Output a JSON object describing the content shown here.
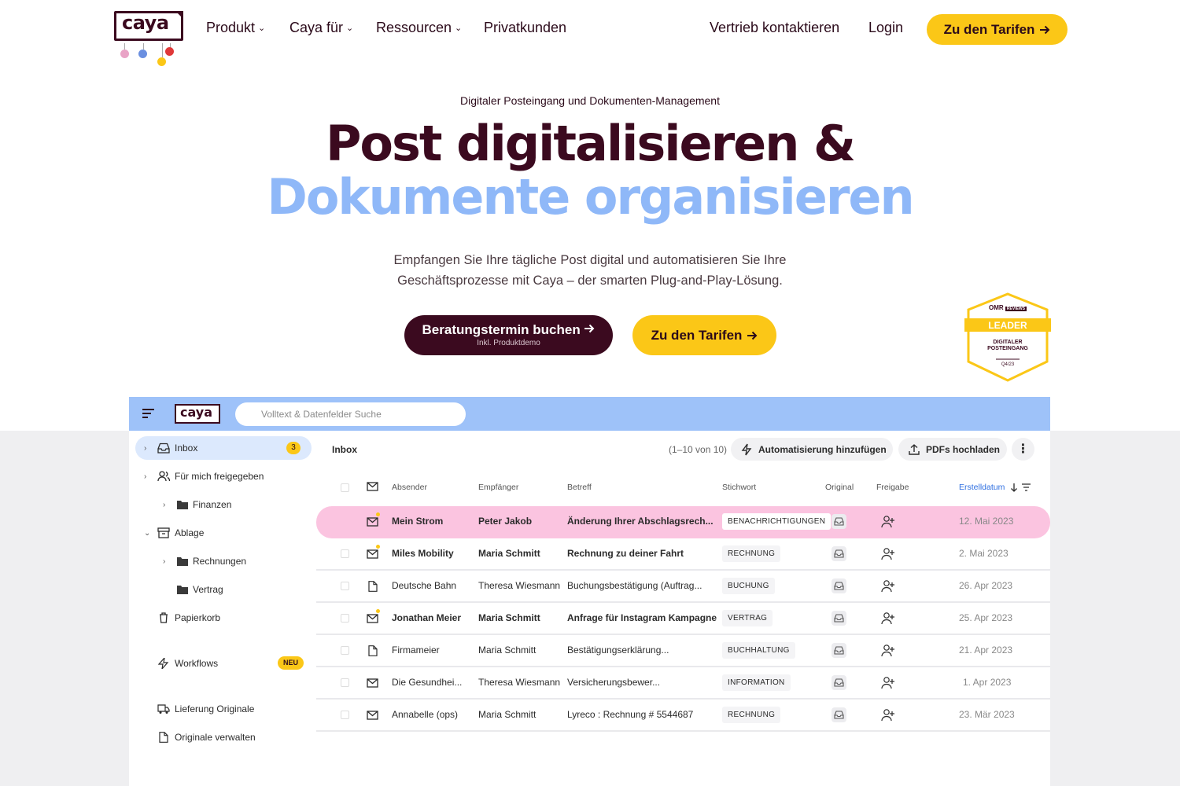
{
  "nav": {
    "logo_text": "caya",
    "links": [
      {
        "label": "Produkt",
        "has_chevron": true
      },
      {
        "label": "Caya für",
        "has_chevron": true
      },
      {
        "label": "Ressourcen",
        "has_chevron": true
      },
      {
        "label": "Privatkunden",
        "has_chevron": false
      }
    ],
    "contact": "Vertrieb kontaktieren",
    "login": "Login",
    "cta": "Zu den Tarifen"
  },
  "hero": {
    "eyebrow": "Digitaler Posteingang und Dokumenten-Management",
    "title_line1": "Post digitalisieren &",
    "title_line2": "Dokumente organisieren",
    "lead_line1": "Empfangen Sie Ihre tägliche Post digital und automatisieren Sie Ihre",
    "lead_line2": "Geschäftsprozesse mit Caya – der smarten Plug-and-Play-Lösung.",
    "primary_button": "Beratungstermin buchen",
    "primary_button_sub": "Inkl. Produktdemo",
    "secondary_button": "Zu den Tarifen"
  },
  "badge": {
    "brand": "OMR",
    "brand_sub": "REVIEWS",
    "ribbon": "LEADER",
    "line1": "DIGITALER",
    "line2": "POSTEINGANG",
    "period": "Q4/23"
  },
  "app": {
    "logo_text": "caya",
    "search_placeholder": "Volltext & Datenfelder Suche",
    "sidebar": [
      {
        "label": "Inbox",
        "count": "3"
      },
      {
        "label": "Für mich freigegeben"
      },
      {
        "label": "Finanzen"
      },
      {
        "label": "Ablage"
      },
      {
        "label": "Rechnungen"
      },
      {
        "label": "Vertrag"
      },
      {
        "label": "Papierkorb"
      },
      {
        "label": "Workflows",
        "badge": "NEU"
      },
      {
        "label": "Lieferung Originale"
      },
      {
        "label": "Originale verwalten"
      }
    ],
    "toolbar": {
      "title": "Inbox",
      "range": "(1–10 von 10)",
      "automation": "Automatisierung hinzufügen",
      "upload": "PDFs hochladen"
    },
    "columns": [
      "Absender",
      "Empfänger",
      "Betreff",
      "Stichwort",
      "Original",
      "Freigabe",
      "Erstelldatum"
    ],
    "rows": [
      {
        "sender": "Mein Strom",
        "recipient": "Peter Jakob",
        "subject": "Änderung Ihrer Abschlagsrech...",
        "tag": "BENACHRICHTIGUNGEN",
        "date": "12. Mai 2023"
      },
      {
        "sender": "Miles Mobility",
        "recipient": "Maria Schmitt",
        "subject": "Rechnung zu deiner Fahrt",
        "tag": "RECHNUNG",
        "date": "2. Mai 2023"
      },
      {
        "sender": "Deutsche Bahn",
        "recipient": "Theresa Wiesmann",
        "subject": "Buchungsbestätigung (Auftrag...",
        "tag": "BUCHUNG",
        "date": "26. Apr 2023"
      },
      {
        "sender": "Jonathan Meier",
        "recipient": "Maria Schmitt",
        "subject": "Anfrage für Instagram Kampagne",
        "tag": "VERTRAG",
        "date": "25. Apr 2023"
      },
      {
        "sender": "Firmameier",
        "recipient": "Maria Schmitt",
        "subject": "Bestätigungserklärung...",
        "tag": "BUCHHALTUNG",
        "date": "21. Apr 2023"
      },
      {
        "sender": "Die Gesundhei...",
        "recipient": "Theresa Wiesmann",
        "subject": "Versicherungsbewer...",
        "tag": "INFORMATION",
        "date": "1. Apr 2023"
      },
      {
        "sender": "Annabelle (ops)",
        "recipient": "Maria Schmitt",
        "subject": "Lyreco : Rechnung # 5544687",
        "tag": "RECHNUNG",
        "date": "23. Mär 2023"
      }
    ]
  },
  "colors": {
    "brand_dark": "#3b0a1f",
    "brand_blue": "#8fb8f8",
    "accent_yellow": "#fbc717",
    "highlight_pink": "#fbc4e0",
    "app_header_blue": "#9ec2f9"
  }
}
